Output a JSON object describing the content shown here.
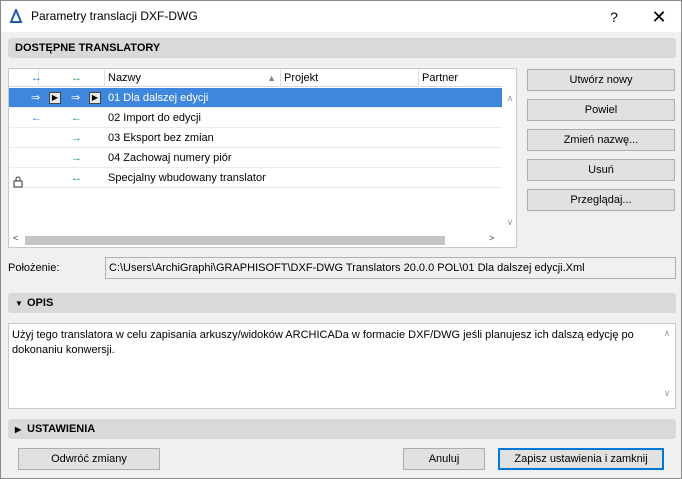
{
  "window": {
    "title": "Parametry translacji DXF-DWG",
    "help_label": "?",
    "close_label": "✕"
  },
  "translators_section": {
    "title": "DOSTĘPNE TRANSLATORY"
  },
  "list": {
    "columns": {
      "import_icon": "↔",
      "export_icon": "↔",
      "name": "Nazwy",
      "project": "Projekt",
      "partner": "Partner"
    },
    "rows": [
      {
        "import": "⇒",
        "export": "⇒",
        "name": "01 Dla dalszej edycji",
        "selected": true
      },
      {
        "import": "←",
        "export": "←",
        "name": "02 Import do edycji",
        "selected": false
      },
      {
        "import": "",
        "export": "→",
        "name": "03 Eksport bez zmian",
        "selected": false
      },
      {
        "import": "",
        "export": "→",
        "name": "04 Zachowaj numery piór",
        "selected": false
      },
      {
        "import": "lock",
        "export": "↔",
        "name": "Specjalny wbudowany translator",
        "selected": false
      }
    ]
  },
  "actions": {
    "create_new": "Utwórz nowy",
    "duplicate": "Powiel",
    "rename": "Zmień nazwę...",
    "delete": "Usuń",
    "browse": "Przeglądaj..."
  },
  "location": {
    "label": "Położenie:",
    "value": "C:\\Users\\ArchiGraphi\\GRAPHISOFT\\DXF-DWG Translators 20.0.0 POL\\01 Dla dalszej edycji.Xml"
  },
  "description_section": {
    "title": "OPIS",
    "text": "Użyj tego translatora w celu zapisania arkuszy/widoków ARCHICADa w formacie DXF/DWG jeśli planujesz ich dalszą edycję po dokonaniu konwersji."
  },
  "settings_section": {
    "title": "USTAWIENIA"
  },
  "footer": {
    "revert": "Odwróć zmiany",
    "cancel": "Anuluj",
    "save_close": "Zapisz ustawienia i zamknij"
  }
}
